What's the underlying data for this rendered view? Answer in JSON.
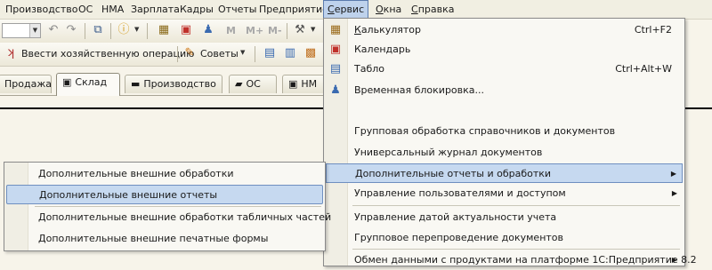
{
  "menubar": {
    "items": [
      "Производство",
      "ОС",
      "НМА",
      "Зарплата",
      "Кадры",
      "Отчеты",
      "Предприятие"
    ],
    "service": {
      "underline": "С",
      "rest": "ервис"
    },
    "windows": {
      "underline": "О",
      "rest": "кна"
    },
    "help": {
      "underline": "С",
      "rest": "правка"
    }
  },
  "toolbar": {
    "m_labels": [
      "M",
      "M+",
      "M-"
    ],
    "action_label": "Ввести хозяйственную операцию",
    "tips_label": "Советы"
  },
  "tabs": [
    "Продажа",
    "Склад",
    "Производство",
    "ОС",
    "НМ"
  ],
  "service_menu": {
    "top_items": [
      {
        "underline": "К",
        "rest": "алькулятор",
        "shortcut": "Ctrl+F2",
        "icon": "calculator-icon"
      },
      {
        "underline": "",
        "rest": "Календарь",
        "shortcut": "",
        "icon": "calendar-icon"
      },
      {
        "underline": "",
        "rest": "Табло",
        "shortcut": "Ctrl+Alt+W",
        "icon": "display-board-icon"
      },
      {
        "underline": "",
        "rest": "Временная блокировка...",
        "shortcut": "",
        "icon": "lock-users-icon"
      }
    ],
    "items": [
      "Групповая обработка справочников и документов",
      "Универсальный журнал документов",
      "Дополнительные отчеты и обработки",
      "Управление пользователями и доступом",
      "Управление датой актуальности учета",
      "Групповое перепроведение документов",
      "Обмен данными с продуктами на платформе 1С:Предприятие 8.2"
    ]
  },
  "submenu": {
    "items": [
      "Дополнительные внешние обработки",
      "Дополнительные внешние отчеты",
      "Дополнительные внешние обработки табличных частей",
      "Дополнительные внешние печатные формы"
    ]
  },
  "colors": {
    "highlight": "#c6d9f0",
    "highlight_border": "#6f8fc0"
  }
}
